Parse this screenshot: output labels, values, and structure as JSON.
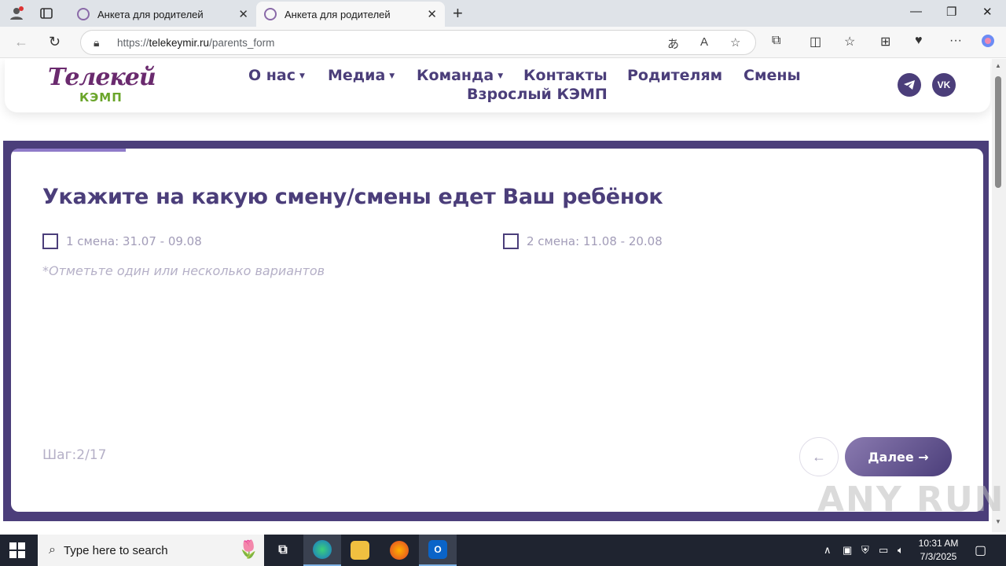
{
  "browser": {
    "tabs": [
      {
        "title": "Анкета для родителей",
        "active": false
      },
      {
        "title": "Анкета для родителей",
        "active": true
      }
    ],
    "url_prefix": "https://",
    "url_domain": "telekeymir.ru",
    "url_path": "/parents_form"
  },
  "site": {
    "logo_top": "Телекей",
    "logo_bottom": "КЭМП",
    "nav": [
      "О нас",
      "Медиа",
      "Команда",
      "Контакты",
      "Родителям",
      "Смены",
      "Взрослый КЭМП"
    ],
    "social": [
      "telegram",
      "vk"
    ],
    "social_vk_label": "VK"
  },
  "form": {
    "progress_fraction": 0.118,
    "question": "Укажите на какую смену/смены едет Ваш ребёнок",
    "options": [
      {
        "label": "1 смена: 31.07 - 09.08",
        "checked": false
      },
      {
        "label": "2 смена: 11.08 - 20.08",
        "checked": false
      }
    ],
    "hint": "*Отметьте один или несколько вариантов",
    "step": "Шаг:2/17",
    "back_icon": "←",
    "next_label": "Далее →"
  },
  "watermark": "ANY RUN",
  "taskbar": {
    "search_placeholder": "Type here to search",
    "time": "10:31 AM",
    "date": "7/3/2025"
  },
  "colors": {
    "brand_purple": "#4b3e7a",
    "progress": "#8f7bc9",
    "muted_text": "#a29cb8",
    "logo_green": "#6aa52a"
  }
}
